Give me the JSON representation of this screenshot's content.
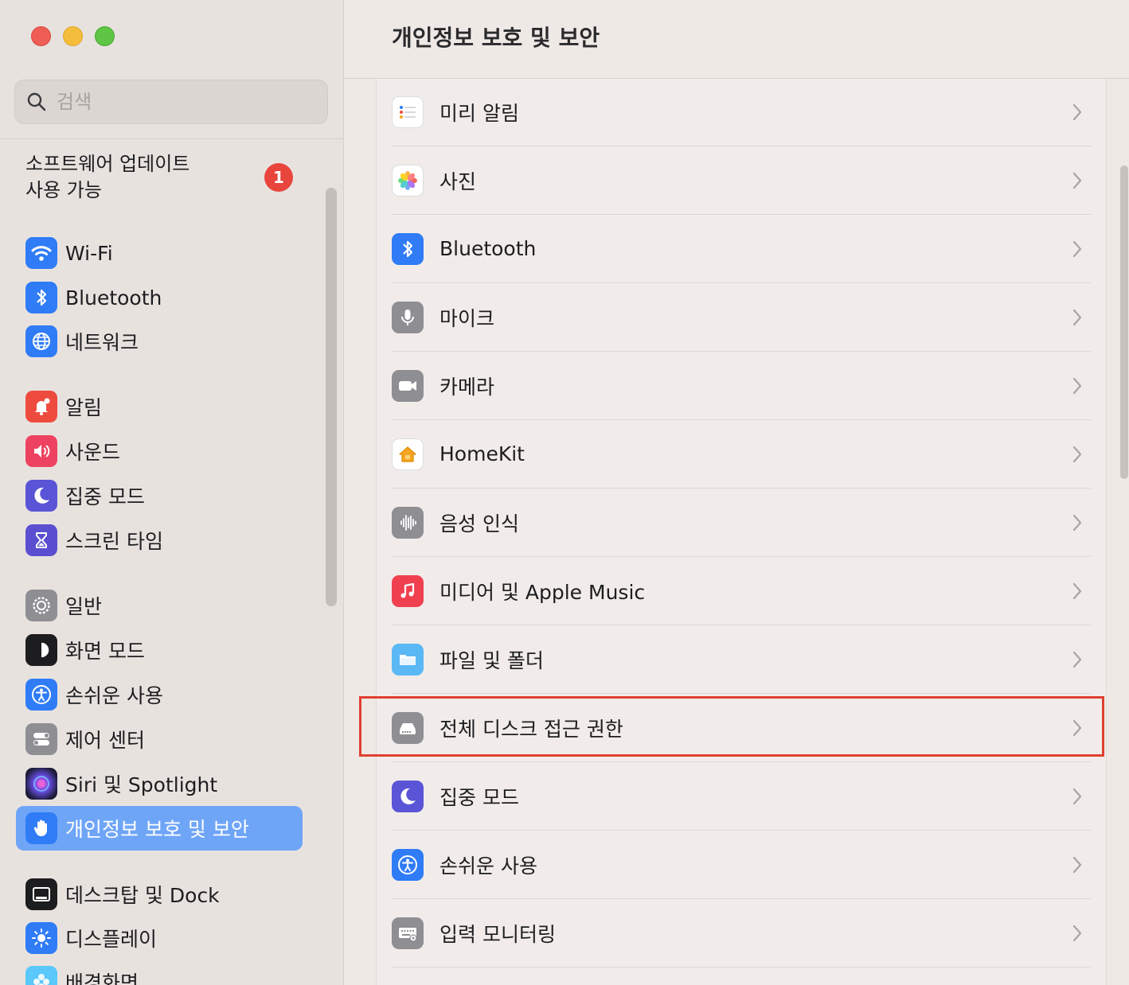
{
  "search": {
    "placeholder": "검색"
  },
  "sidebar": {
    "update": {
      "line1": "소프트웨어 업데이트",
      "line2": "사용 가능",
      "badge": "1"
    },
    "items": [
      {
        "label": "Wi-Fi",
        "icon": "wifi-icon"
      },
      {
        "label": "Bluetooth",
        "icon": "bluetooth-icon"
      },
      {
        "label": "네트워크",
        "icon": "globe-icon"
      },
      {
        "label": "알림",
        "icon": "bell-icon"
      },
      {
        "label": "사운드",
        "icon": "speaker-icon"
      },
      {
        "label": "집중 모드",
        "icon": "moon-icon"
      },
      {
        "label": "스크린 타임",
        "icon": "hourglass-icon"
      },
      {
        "label": "일반",
        "icon": "gear-icon"
      },
      {
        "label": "화면 모드",
        "icon": "appearance-icon"
      },
      {
        "label": "손쉬운 사용",
        "icon": "accessibility-icon"
      },
      {
        "label": "제어 센터",
        "icon": "toggles-icon"
      },
      {
        "label": "Siri 및 Spotlight",
        "icon": "siri-icon"
      },
      {
        "label": "개인정보 보호 및 보안",
        "icon": "hand-icon",
        "selected": true
      },
      {
        "label": "데스크탑 및 Dock",
        "icon": "dock-icon"
      },
      {
        "label": "디스플레이",
        "icon": "sun-icon"
      },
      {
        "label": "배경화면",
        "icon": "flower-icon"
      }
    ]
  },
  "main": {
    "title": "개인정보 보호 및 보안",
    "rows": [
      {
        "label": "미리 알림",
        "icon": "reminders-icon"
      },
      {
        "label": "사진",
        "icon": "photos-icon"
      },
      {
        "label": "Bluetooth",
        "icon": "bluetooth-icon"
      },
      {
        "label": "마이크",
        "icon": "microphone-icon"
      },
      {
        "label": "카메라",
        "icon": "camera-icon"
      },
      {
        "label": "HomeKit",
        "icon": "home-icon"
      },
      {
        "label": "음성 인식",
        "icon": "waveform-icon"
      },
      {
        "label": "미디어 및 Apple Music",
        "icon": "music-icon"
      },
      {
        "label": "파일 및 폴더",
        "icon": "folder-icon"
      },
      {
        "label": "전체 디스크 접근 권한",
        "icon": "disk-icon",
        "highlighted": true
      },
      {
        "label": "집중 모드",
        "icon": "moon-icon"
      },
      {
        "label": "손쉬운 사용",
        "icon": "accessibility-icon"
      },
      {
        "label": "입력 모니터링",
        "icon": "keyboard-icon"
      }
    ]
  },
  "colors": {
    "accent": "#6ea5f7",
    "highlight_border": "#e0402f",
    "badge": "#e8453c"
  }
}
